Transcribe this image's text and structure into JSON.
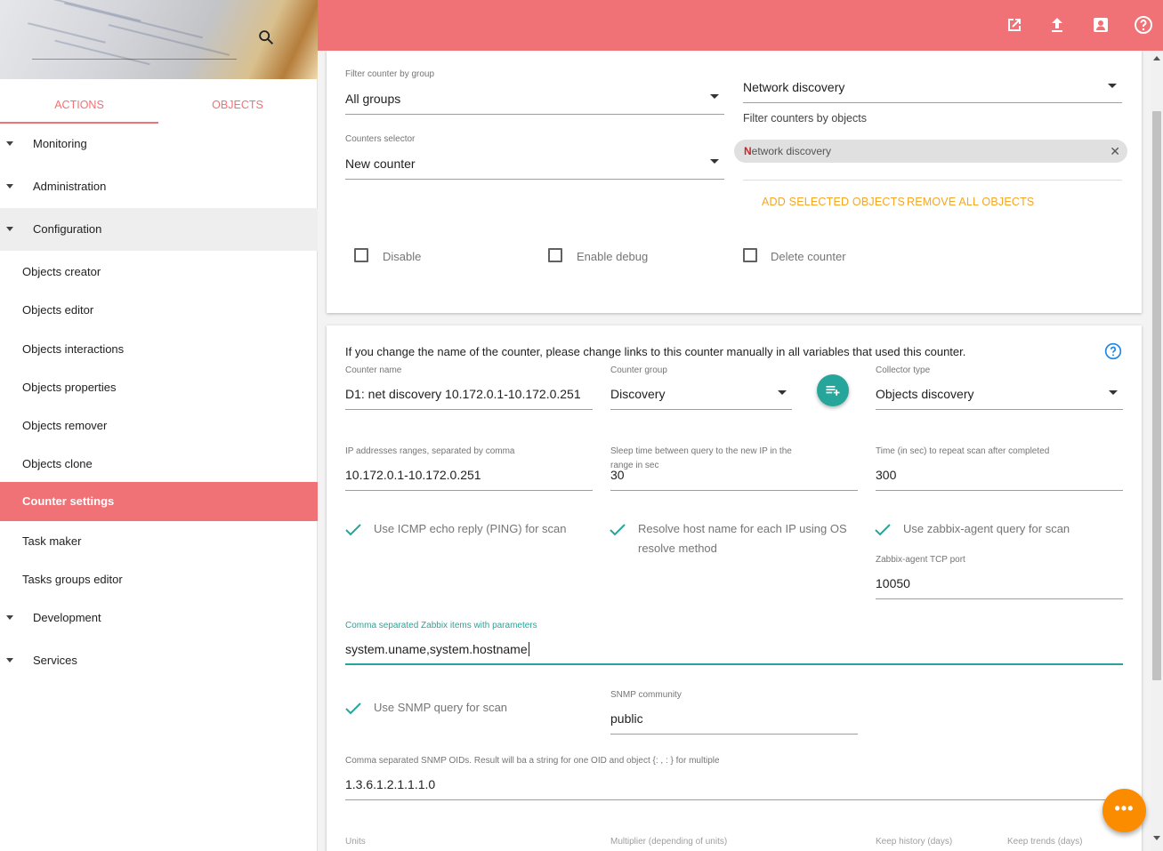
{
  "sidebar": {
    "tabs": {
      "actions": "ACTIONS",
      "objects": "OBJECTS"
    },
    "groups": {
      "monitoring": "Monitoring",
      "administration": "Administration",
      "configuration": "Configuration",
      "development": "Development",
      "services": "Services"
    },
    "items": {
      "objects_creator": "Objects creator",
      "objects_editor": "Objects editor",
      "objects_interactions": "Objects interactions",
      "objects_properties": "Objects properties",
      "objects_remover": "Objects remover",
      "objects_clone": "Objects clone",
      "counter_settings": "Counter settings",
      "task_maker": "Task maker",
      "tasks_groups_editor": "Tasks groups editor"
    }
  },
  "topbar": {
    "icons": [
      "open-in-new-icon",
      "upload-icon",
      "contact-card-icon",
      "help-icon"
    ]
  },
  "colors": {
    "accent": "#f07176",
    "teal": "#26a69a",
    "orange": "#f5a623",
    "fab": "#fb8c00"
  },
  "card1": {
    "filter_group": {
      "label": "Filter counter by group",
      "value": "All groups"
    },
    "counters_selector": {
      "label": "Counters selector",
      "value": "New counter"
    },
    "objects_filter": {
      "value": "Network discovery",
      "hint": "Filter counters by objects"
    },
    "chip": {
      "first_letter": "N",
      "rest": "etwork discovery"
    },
    "add_selected": "ADD SELECTED OBJECTS",
    "remove_all": "REMOVE ALL OBJECTS",
    "checkboxes": {
      "disable": "Disable",
      "debug": "Enable debug",
      "delete": "Delete counter"
    }
  },
  "card2": {
    "info": "If you change the name of the counter, please change links to this counter manually in all variables that used this counter.",
    "counter_name": {
      "label": "Counter name",
      "value": "D1: net discovery 10.172.0.1-10.172.0.251"
    },
    "counter_group": {
      "label": "Counter group",
      "value": "Discovery"
    },
    "collector_type": {
      "label": "Collector type",
      "value": "Objects discovery"
    },
    "ip_ranges": {
      "label": "IP addresses ranges, separated by comma",
      "value": "10.172.0.1-10.172.0.251"
    },
    "sleep_time": {
      "label1": "Sleep time between query to the new IP in the",
      "label2": "range in sec",
      "value": "30"
    },
    "repeat_time": {
      "label": "Time (in sec) to repeat scan after completed",
      "value": "300"
    },
    "use_icmp": "Use ICMP echo reply (PING) for scan",
    "resolve_host_1": "Resolve host name for each IP using OS",
    "resolve_host_2": "resolve method",
    "use_zabbix": "Use zabbix-agent query for scan",
    "zabbix_port": {
      "label": "Zabbix-agent TCP port",
      "value": "10050"
    },
    "zabbix_items": {
      "label": "Comma separated Zabbix items with parameters",
      "value": "system.uname,system.hostname"
    },
    "use_snmp": "Use SNMP query for scan",
    "snmp_community": {
      "label": "SNMP community",
      "value": "public"
    },
    "snmp_oids": {
      "label": "Comma separated SNMP OIDs. Result will ba a string for one OID and object {: , : } for multiple",
      "value": "1.3.6.1.2.1.1.1.0"
    },
    "bottom_labels": {
      "units": "Units",
      "multiplier": "Multiplier (depending of units)",
      "keep_history": "Keep history (days)",
      "keep_trends": "Keep trends (days)"
    }
  },
  "fab": {
    "label": "•••"
  }
}
